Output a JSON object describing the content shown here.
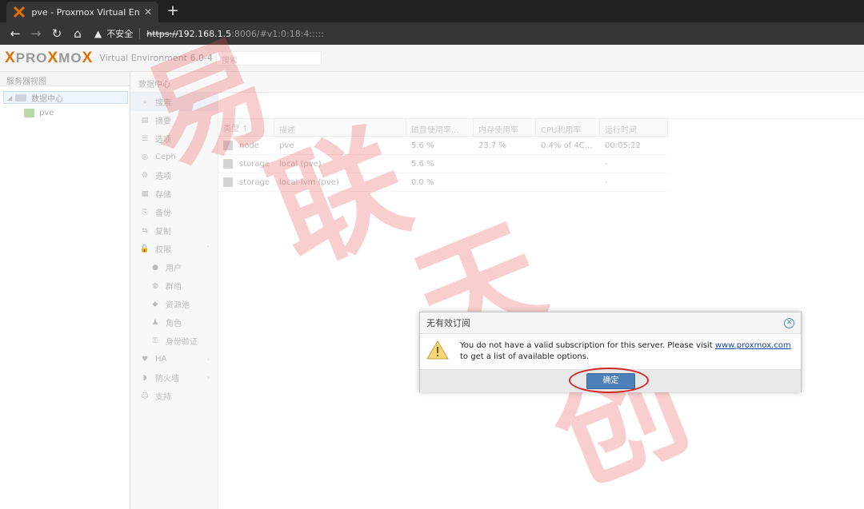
{
  "browser": {
    "tab_title": "pve - Proxmox Virtual Environment",
    "tab_close": "✕",
    "new_tab": "+",
    "back": "←",
    "forward": "→",
    "reload": "↻",
    "home": "⌂",
    "security_label": "不安全",
    "url_scheme": "https://",
    "url_host": "192.168.1.5",
    "url_rest": ":8006/#v1:0:18:4:::::"
  },
  "header": {
    "logo_a": "PRO",
    "logo_x": "X",
    "logo_b": "MO",
    "logo_x2": "X",
    "version": "Virtual Environment 6.0-4",
    "search_placeholder": "搜索"
  },
  "tree": {
    "view_label": "服务器视图",
    "datacenter": "数据中心",
    "node": "pve"
  },
  "content": {
    "title": "数据中心"
  },
  "menu": [
    {
      "label": "搜索",
      "icon": "⌕"
    },
    {
      "label": "摘要",
      "icon": "▤"
    },
    {
      "label": "选项",
      "icon": "☰"
    },
    {
      "label": "Ceph",
      "icon": "◎"
    },
    {
      "label": "选项",
      "icon": "⚙"
    },
    {
      "label": "存储",
      "icon": "▦"
    },
    {
      "label": "备份",
      "icon": "⎘"
    },
    {
      "label": "复制",
      "icon": "⇆"
    },
    {
      "label": "权限",
      "icon": "🔓",
      "chevron": "˅"
    },
    {
      "label": "用户",
      "icon": "●"
    },
    {
      "label": "群组",
      "icon": "◍"
    },
    {
      "label": "资源池",
      "icon": "◆"
    },
    {
      "label": "角色",
      "icon": "♟"
    },
    {
      "label": "身份验证",
      "icon": "⚿"
    },
    {
      "label": "HA",
      "icon": "♥",
      "chevron": "›"
    },
    {
      "label": "防火墙",
      "icon": "◗",
      "chevron": "›"
    },
    {
      "label": "支持",
      "icon": "☺"
    }
  ],
  "grid": {
    "headers": [
      "类型 ↑",
      "描述",
      "磁盘使用率...",
      "内存使用率",
      "CPU利用率",
      "运行时间"
    ],
    "rows": [
      [
        "node",
        "pve",
        "5.6 %",
        "23.7 %",
        "0.4% of 4C...",
        "00:05:22"
      ],
      [
        "storage",
        "local (pve)",
        "5.6 %",
        "",
        "",
        "-"
      ],
      [
        "storage",
        "local-lvm (pve)",
        "0.0 %",
        "",
        "",
        "-"
      ]
    ]
  },
  "modal": {
    "title": "无有效订阅",
    "close": "✕",
    "message_pre": "You do not have a valid subscription for this server. Please visit ",
    "link": "www.proxmox.com",
    "message_post": " to get a list of available options.",
    "ok": "确定"
  },
  "watermark": {
    "chars": [
      "易",
      "联",
      "天",
      "创"
    ]
  },
  "colors": {
    "accent": "#e57000",
    "link": "#1a44a8",
    "button": "#4d7fb8",
    "highlight_ring": "#d6262a"
  }
}
